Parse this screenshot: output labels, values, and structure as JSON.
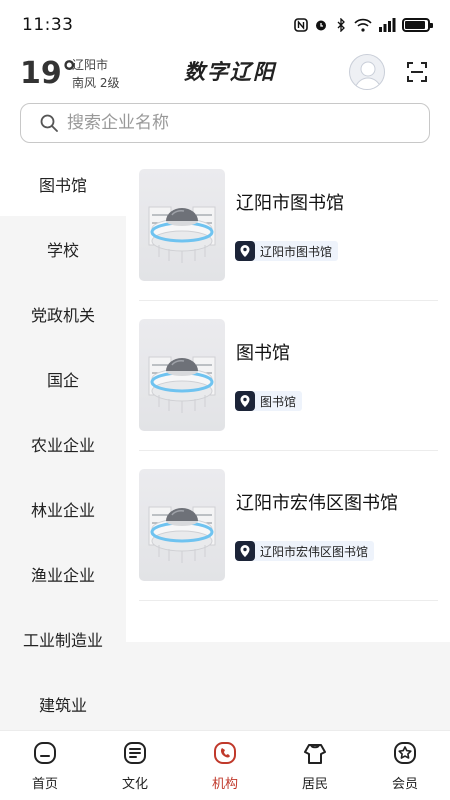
{
  "status_bar": {
    "time": "11:33",
    "icons": [
      "nfc-icon",
      "alarm-icon",
      "bluetooth-icon",
      "wifi-icon",
      "signal-icon",
      "battery-icon"
    ],
    "battery_level": 0.9
  },
  "header": {
    "temperature": "19°",
    "city": "辽阳市",
    "wind": "南风  2级",
    "title": "数字辽阳"
  },
  "search": {
    "placeholder": "搜索企业名称"
  },
  "sidebar": {
    "items": [
      {
        "label": "图书馆",
        "active": true
      },
      {
        "label": "学校",
        "active": false
      },
      {
        "label": "党政机关",
        "active": false
      },
      {
        "label": "国企",
        "active": false
      },
      {
        "label": "农业企业",
        "active": false
      },
      {
        "label": "林业企业",
        "active": false
      },
      {
        "label": "渔业企业",
        "active": false
      },
      {
        "label": "工业制造业",
        "active": false
      },
      {
        "label": "建筑业",
        "active": false
      }
    ]
  },
  "list": {
    "items": [
      {
        "title": "辽阳市图书馆",
        "location": "辽阳市图书馆"
      },
      {
        "title": "图书馆",
        "location": "图书馆"
      },
      {
        "title": "辽阳市宏伟区图书馆",
        "location": "辽阳市宏伟区图书馆"
      }
    ]
  },
  "bottom_nav": {
    "items": [
      {
        "label": "首页",
        "icon": "home-icon",
        "active": false
      },
      {
        "label": "文化",
        "icon": "culture-icon",
        "active": false
      },
      {
        "label": "机构",
        "icon": "institution-icon",
        "active": true
      },
      {
        "label": "居民",
        "icon": "resident-icon",
        "active": false
      },
      {
        "label": "会员",
        "icon": "member-icon",
        "active": false
      }
    ]
  },
  "colors": {
    "accent": "#c0392b",
    "sidebar_bg": "#f5f5f5",
    "tag_bg": "#eef3fb",
    "pin_bg": "#1c2438"
  }
}
